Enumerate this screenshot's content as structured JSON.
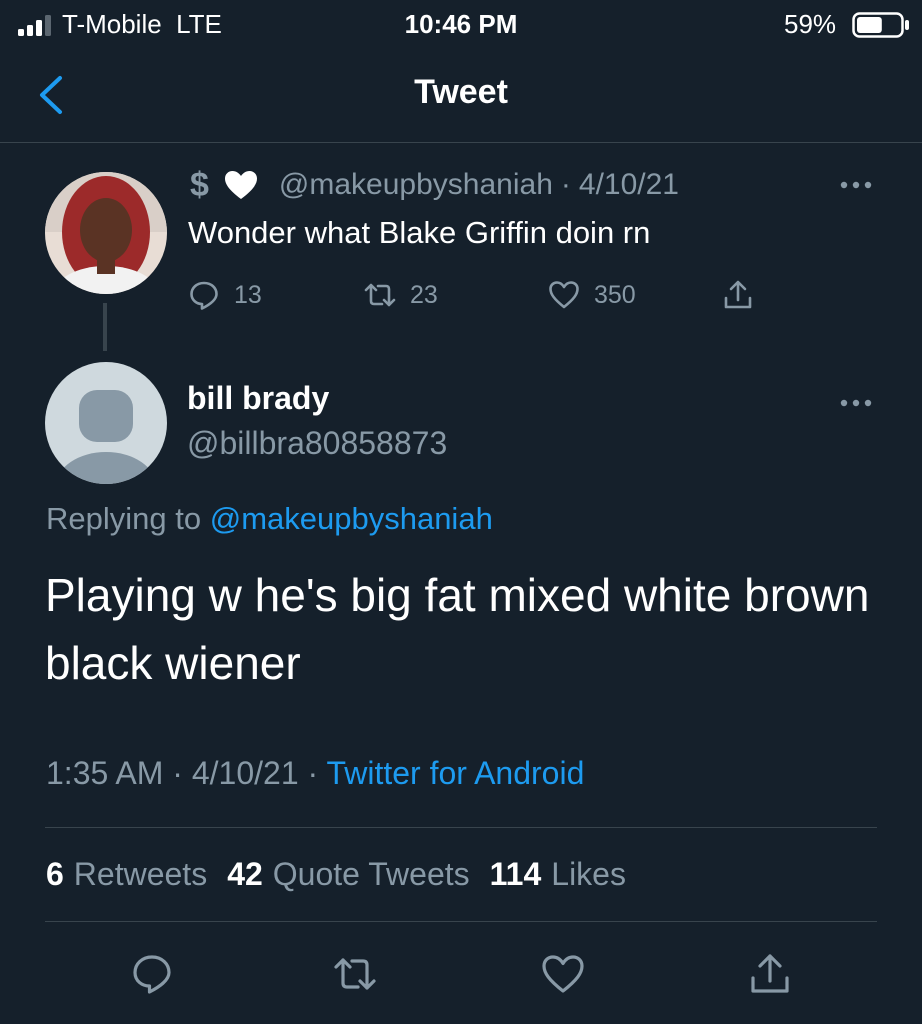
{
  "status_bar": {
    "carrier": "T-Mobile  LTE",
    "time": "10:46 PM",
    "battery_percent": "59%",
    "battery_level": 0.59
  },
  "nav": {
    "back_icon": "chevron-left-icon",
    "title": "Tweet"
  },
  "parent_tweet": {
    "name_prefix": "$",
    "name_emoji": "white-heart-icon",
    "handle": "@makeupbyshaniah",
    "separator": "·",
    "date": "4/10/21",
    "text": "Wonder what Blake Griffin doin rn",
    "replies": "13",
    "retweets": "23",
    "likes": "350"
  },
  "main_tweet": {
    "display_name": "bill brady",
    "handle": "@billbra80858873",
    "replying_prefix": "Replying to",
    "replying_handle": "@makeupbyshaniah",
    "text": "Playing w he's big fat mixed white brown black wiener",
    "time": "1:35 AM",
    "sep1": "·",
    "date": "4/10/21",
    "sep2": "·",
    "source": "Twitter for Android",
    "retweets_count": "6",
    "retweets_label": "Retweets",
    "quotes_count": "42",
    "quotes_label": "Quote Tweets",
    "likes_count": "114",
    "likes_label": "Likes"
  },
  "colors": {
    "background": "#15202b",
    "accent": "#1d9bf0",
    "muted": "#8899a6",
    "divider": "#38444d"
  }
}
